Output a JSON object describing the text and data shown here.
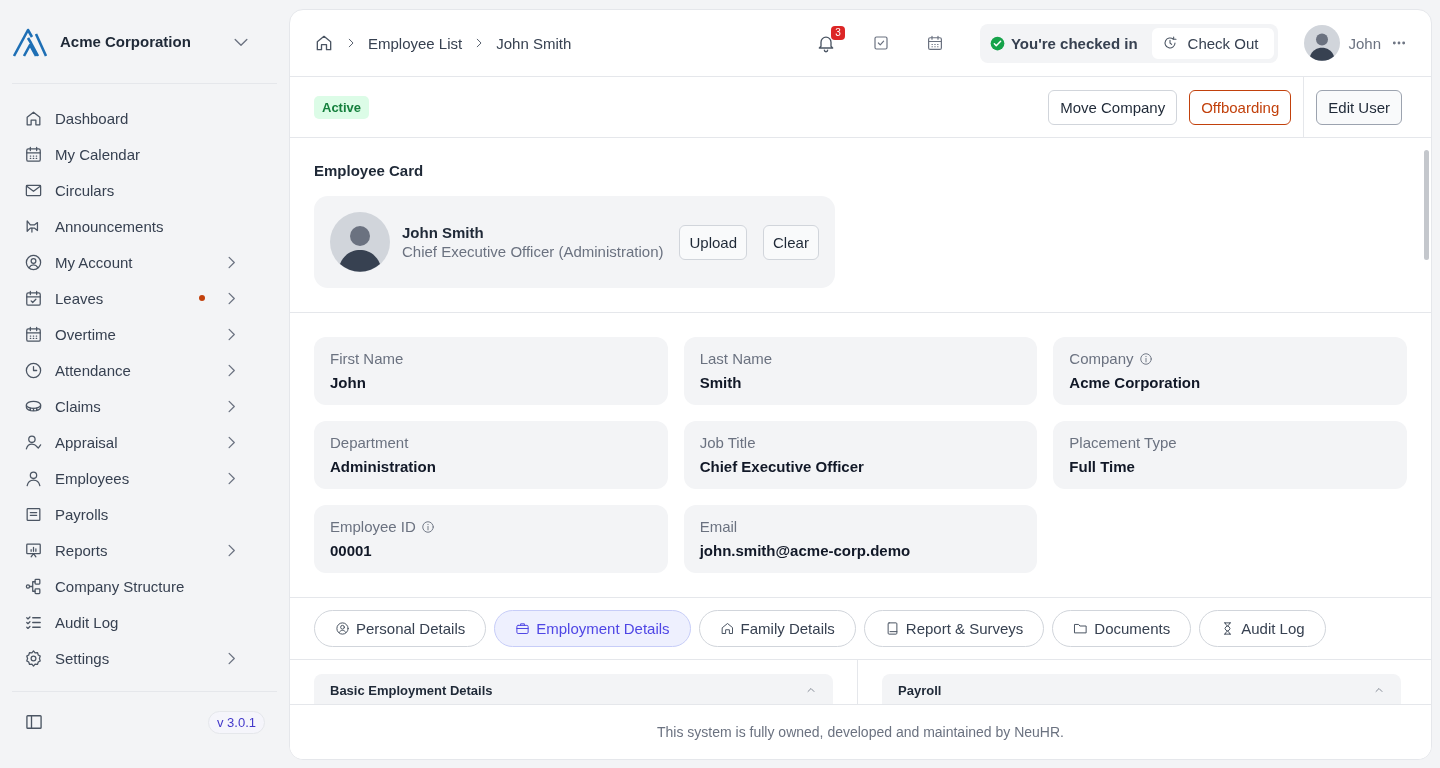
{
  "sidebar": {
    "company": "Acme Corporation",
    "items": [
      {
        "label": "Dashboard",
        "has_submenu": false,
        "notification": false
      },
      {
        "label": "My Calendar",
        "has_submenu": false,
        "notification": false
      },
      {
        "label": "Circulars",
        "has_submenu": false,
        "notification": false
      },
      {
        "label": "Announcements",
        "has_submenu": false,
        "notification": false
      },
      {
        "label": "My Account",
        "has_submenu": true,
        "notification": false
      },
      {
        "label": "Leaves",
        "has_submenu": true,
        "notification": true
      },
      {
        "label": "Overtime",
        "has_submenu": true,
        "notification": false
      },
      {
        "label": "Attendance",
        "has_submenu": true,
        "notification": false
      },
      {
        "label": "Claims",
        "has_submenu": true,
        "notification": false
      },
      {
        "label": "Appraisal",
        "has_submenu": true,
        "notification": false
      },
      {
        "label": "Employees",
        "has_submenu": true,
        "notification": false
      },
      {
        "label": "Payrolls",
        "has_submenu": false,
        "notification": false
      },
      {
        "label": "Reports",
        "has_submenu": true,
        "notification": false
      },
      {
        "label": "Company Structure",
        "has_submenu": false,
        "notification": false
      },
      {
        "label": "Audit Log",
        "has_submenu": false,
        "notification": false
      },
      {
        "label": "Settings",
        "has_submenu": true,
        "notification": false
      }
    ],
    "version": "v 3.0.1"
  },
  "header": {
    "breadcrumb": [
      "Employee List",
      "John Smith"
    ],
    "notification_count": "3",
    "checkin_status": "You're checked in",
    "checkout_label": "Check Out",
    "user_name": "John"
  },
  "status_badge": "Active",
  "actions": [
    {
      "label": "Move Company",
      "kind": "default"
    },
    {
      "label": "Offboarding",
      "kind": "danger"
    },
    {
      "label": "Edit User",
      "kind": "separated"
    }
  ],
  "employee_card": {
    "title": "Employee Card",
    "name": "John Smith",
    "subtitle": "Chief Executive Officer (Administration)",
    "buttons": [
      "Upload",
      "Clear"
    ]
  },
  "fields": [
    {
      "label": "First Name",
      "value": "John",
      "info": false
    },
    {
      "label": "Last Name",
      "value": "Smith",
      "info": false
    },
    {
      "label": "Company",
      "value": "Acme Corporation",
      "info": true
    },
    {
      "label": "Department",
      "value": "Administration",
      "info": false
    },
    {
      "label": "Job Title",
      "value": "Chief Executive Officer",
      "info": false
    },
    {
      "label": "Placement Type",
      "value": "Full Time",
      "info": false
    },
    {
      "label": "Employee ID",
      "value": "00001",
      "info": true
    },
    {
      "label": "Email",
      "value": "john.smith@acme-corp.demo",
      "info": false
    }
  ],
  "tabs": [
    {
      "label": "Personal Details",
      "selected": false
    },
    {
      "label": "Employment Details",
      "selected": true
    },
    {
      "label": "Family Details",
      "selected": false
    },
    {
      "label": "Report & Surveys",
      "selected": false
    },
    {
      "label": "Documents",
      "selected": false
    },
    {
      "label": "Audit Log",
      "selected": false
    }
  ],
  "panels": [
    {
      "title": "Basic Employment Details",
      "expanded": true
    },
    {
      "title": "Payroll",
      "expanded": true
    }
  ],
  "footer": "This system is fully owned, developed and maintained by NeuHR."
}
